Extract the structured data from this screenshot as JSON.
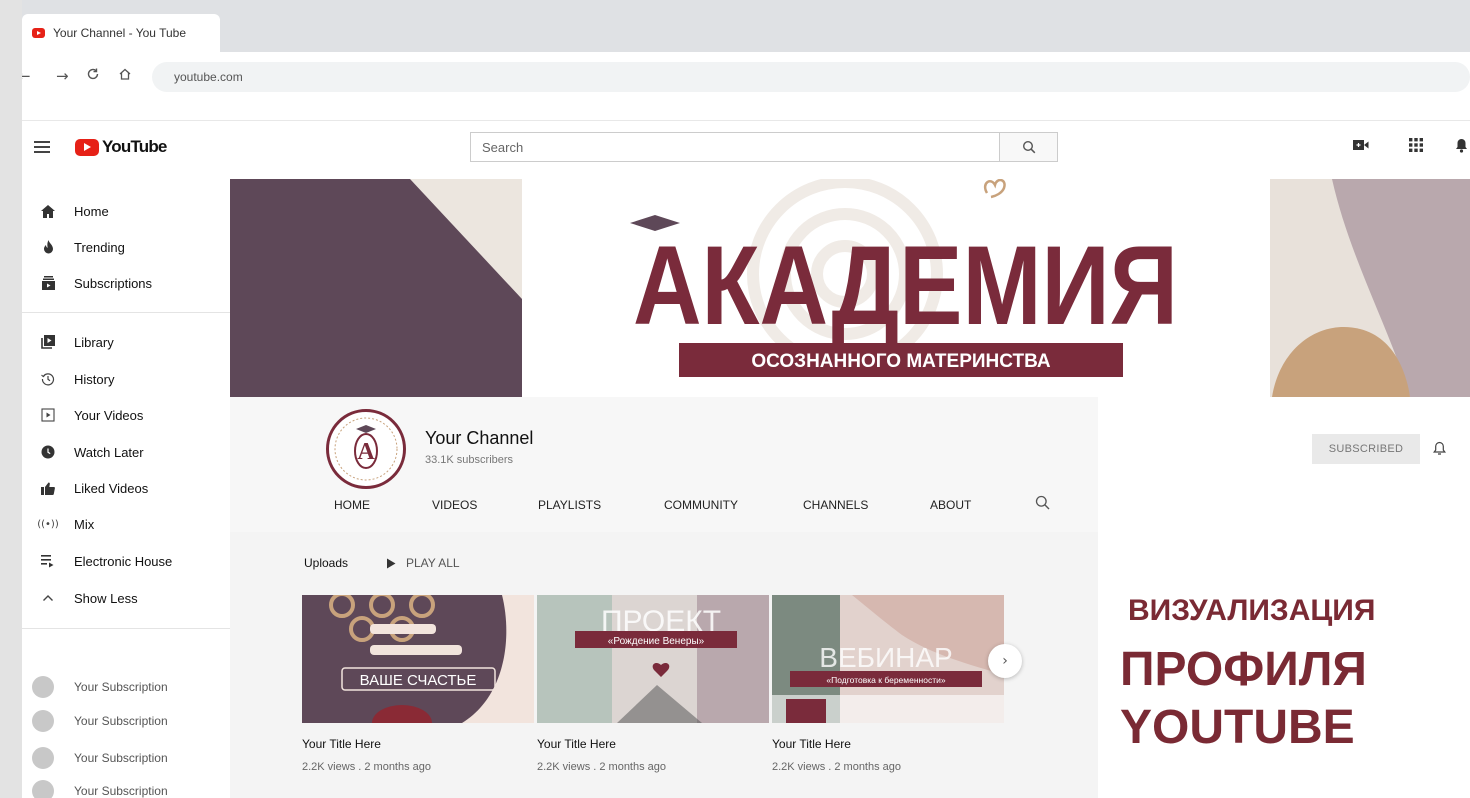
{
  "browser": {
    "tab_title": "Your Channel - You Tube",
    "url": "youtube.com"
  },
  "masthead": {
    "logo_text": "YouTube",
    "search_placeholder": "Search"
  },
  "sidebar": {
    "items": [
      {
        "label": "Home",
        "icon": "home-icon"
      },
      {
        "label": "Trending",
        "icon": "fire-icon"
      },
      {
        "label": "Subscriptions",
        "icon": "subscriptions-icon"
      },
      {
        "label": "Library",
        "icon": "library-icon"
      },
      {
        "label": "History",
        "icon": "history-icon"
      },
      {
        "label": "Your Videos",
        "icon": "your-videos-icon"
      },
      {
        "label": "Watch Later",
        "icon": "clock-icon"
      },
      {
        "label": "Liked Videos",
        "icon": "thumbs-up-icon"
      },
      {
        "label": "Mix",
        "icon": "radio-icon"
      },
      {
        "label": "Electronic House",
        "icon": "playlist-icon"
      },
      {
        "label": "Show Less",
        "icon": "chevron-up-icon"
      }
    ],
    "subscriptions": [
      "Your Subscription",
      "Your Subscription",
      "Your Subscription",
      "Your Subscription"
    ]
  },
  "banner": {
    "title": "АКАДЕМИЯ",
    "subtitle": "ОСОЗНАННОГО МАТЕРИНСТВА",
    "colors": {
      "plum": "#5e4858",
      "maroon": "#7a2b3b",
      "sand": "#c8a27c",
      "sage": "#8fa096",
      "mauve": "#b9a8ad"
    }
  },
  "channel": {
    "name": "Your Channel",
    "subscribers": "33.1K subscribers",
    "subscribe_button": "SUBSCRIBED",
    "avatar_letter": "A",
    "tabs": [
      "HOME",
      "VIDEOS",
      "PLAYLISTS",
      "COMMUNITY",
      "CHANNELS",
      "ABOUT"
    ]
  },
  "uploads": {
    "title": "Uploads",
    "play_all": "PLAY ALL",
    "videos": [
      {
        "title": "Your Title Here",
        "meta": "2.2K views . 2 months ago",
        "thumb_text": "ВАШЕ СЧАСТЬЕ"
      },
      {
        "title": "Your Title Here",
        "meta": "2.2K views . 2 months ago",
        "thumb_text_big": "ПРОЕКТ",
        "thumb_text": "«Рождение Венеры»"
      },
      {
        "title": "Your Title Here",
        "meta": "2.2K views . 2 months ago",
        "thumb_text_big": "ВЕБИНАР",
        "thumb_text": "«Подготовка к беременности»"
      }
    ]
  },
  "promo": {
    "line1": "ВИЗУАЛИЗАЦИЯ",
    "line2": "ПРОФИЛЯ",
    "line3": "YOUTUBE",
    "color": "#7a2a34"
  }
}
